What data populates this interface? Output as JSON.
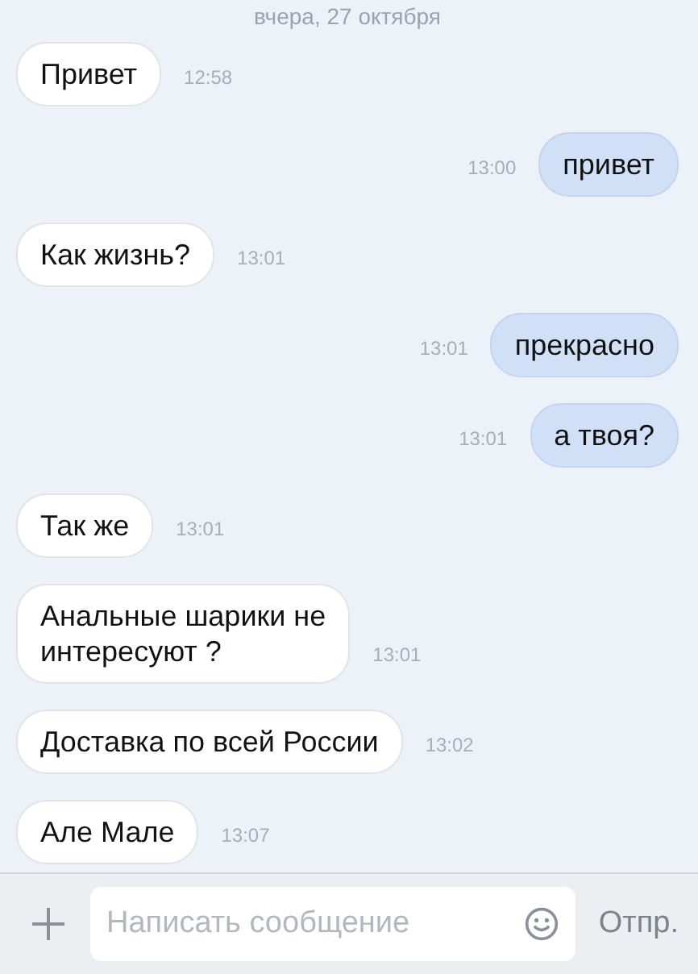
{
  "date_header": "вчера, 27 октября",
  "messages": [
    {
      "kind": "incoming",
      "text": "Привет",
      "time": "12:58"
    },
    {
      "kind": "outgoing",
      "text": "привет",
      "time": "13:00"
    },
    {
      "kind": "incoming",
      "text": "Как жизнь?",
      "time": "13:01"
    },
    {
      "kind": "outgoing",
      "text": "прекрасно",
      "time": "13:01"
    },
    {
      "kind": "outgoing",
      "text": "а твоя?",
      "time": "13:01"
    },
    {
      "kind": "incoming",
      "text": "Так же",
      "time": "13:01"
    },
    {
      "kind": "incoming",
      "text": "Анальные шарики не\nинтересуют ?",
      "time": "13:01"
    },
    {
      "kind": "incoming",
      "text": "Доставка по всей России",
      "time": "13:02"
    },
    {
      "kind": "incoming",
      "text": "Але Мале",
      "time": "13:07"
    }
  ],
  "composer": {
    "placeholder": "Написать сообщение",
    "send_label": "Отпр."
  }
}
